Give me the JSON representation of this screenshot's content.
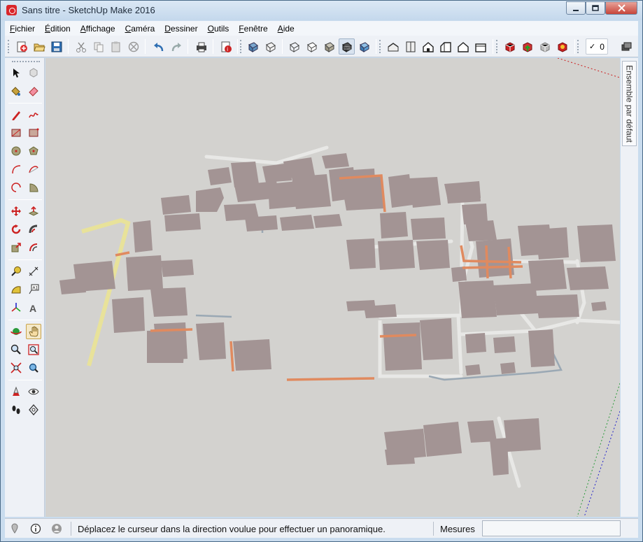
{
  "window": {
    "title": "Sans titre - SketchUp Make 2016",
    "minimize_icon": "minimize-icon",
    "maximize_icon": "maximize-icon",
    "close_icon": "close-icon"
  },
  "menubar": {
    "items": [
      {
        "label": "Fichier",
        "underline": "F",
        "rest": "ichier"
      },
      {
        "label": "Édition",
        "underline": "É",
        "rest": "dition"
      },
      {
        "label": "Affichage",
        "underline": "A",
        "rest": "ffichage"
      },
      {
        "label": "Caméra",
        "underline": "C",
        "rest": "améra"
      },
      {
        "label": "Dessiner",
        "underline": "D",
        "rest": "essiner"
      },
      {
        "label": "Outils",
        "underline": "O",
        "rest": "utils"
      },
      {
        "label": "Fenêtre",
        "underline": "F",
        "rest": "enêtre"
      },
      {
        "label": "Aide",
        "underline": "A",
        "rest": "ide"
      }
    ]
  },
  "toolbar": {
    "check_value": "✓",
    "zero_value": "0",
    "icons": [
      "new-file-icon",
      "open-file-icon",
      "save-icon",
      "cut-icon",
      "copy-icon",
      "paste-icon",
      "erase-icon",
      "undo-icon",
      "redo-icon",
      "print-icon",
      "model-info-icon",
      "xray-icon",
      "back-edges-icon",
      "wireframe-icon",
      "hidden-line-icon",
      "shaded-icon",
      "shaded-textures-icon",
      "monochrome-icon",
      "iso-view-icon",
      "top-view-icon",
      "front-view-icon",
      "right-view-icon",
      "back-view-icon",
      "left-view-icon",
      "warehouse-icon",
      "share-model-icon",
      "share-component-icon",
      "extension-warehouse-icon",
      "layers-icon"
    ]
  },
  "tray": {
    "tab_label": "Ensemble par défaut"
  },
  "statusbar": {
    "hint": "Déplacez le curseur dans la direction voulue pour effectuer un panoramique.",
    "measure_label": "Mesures",
    "measure_value": ""
  },
  "colors": {
    "building": "#a39494",
    "road": "#e8e8e6",
    "highlight_orange": "#e08a5f",
    "yellow_path": "#e8e29a",
    "blue_path": "#9aa8b4",
    "viewport_bg": "#d3d2cf"
  }
}
